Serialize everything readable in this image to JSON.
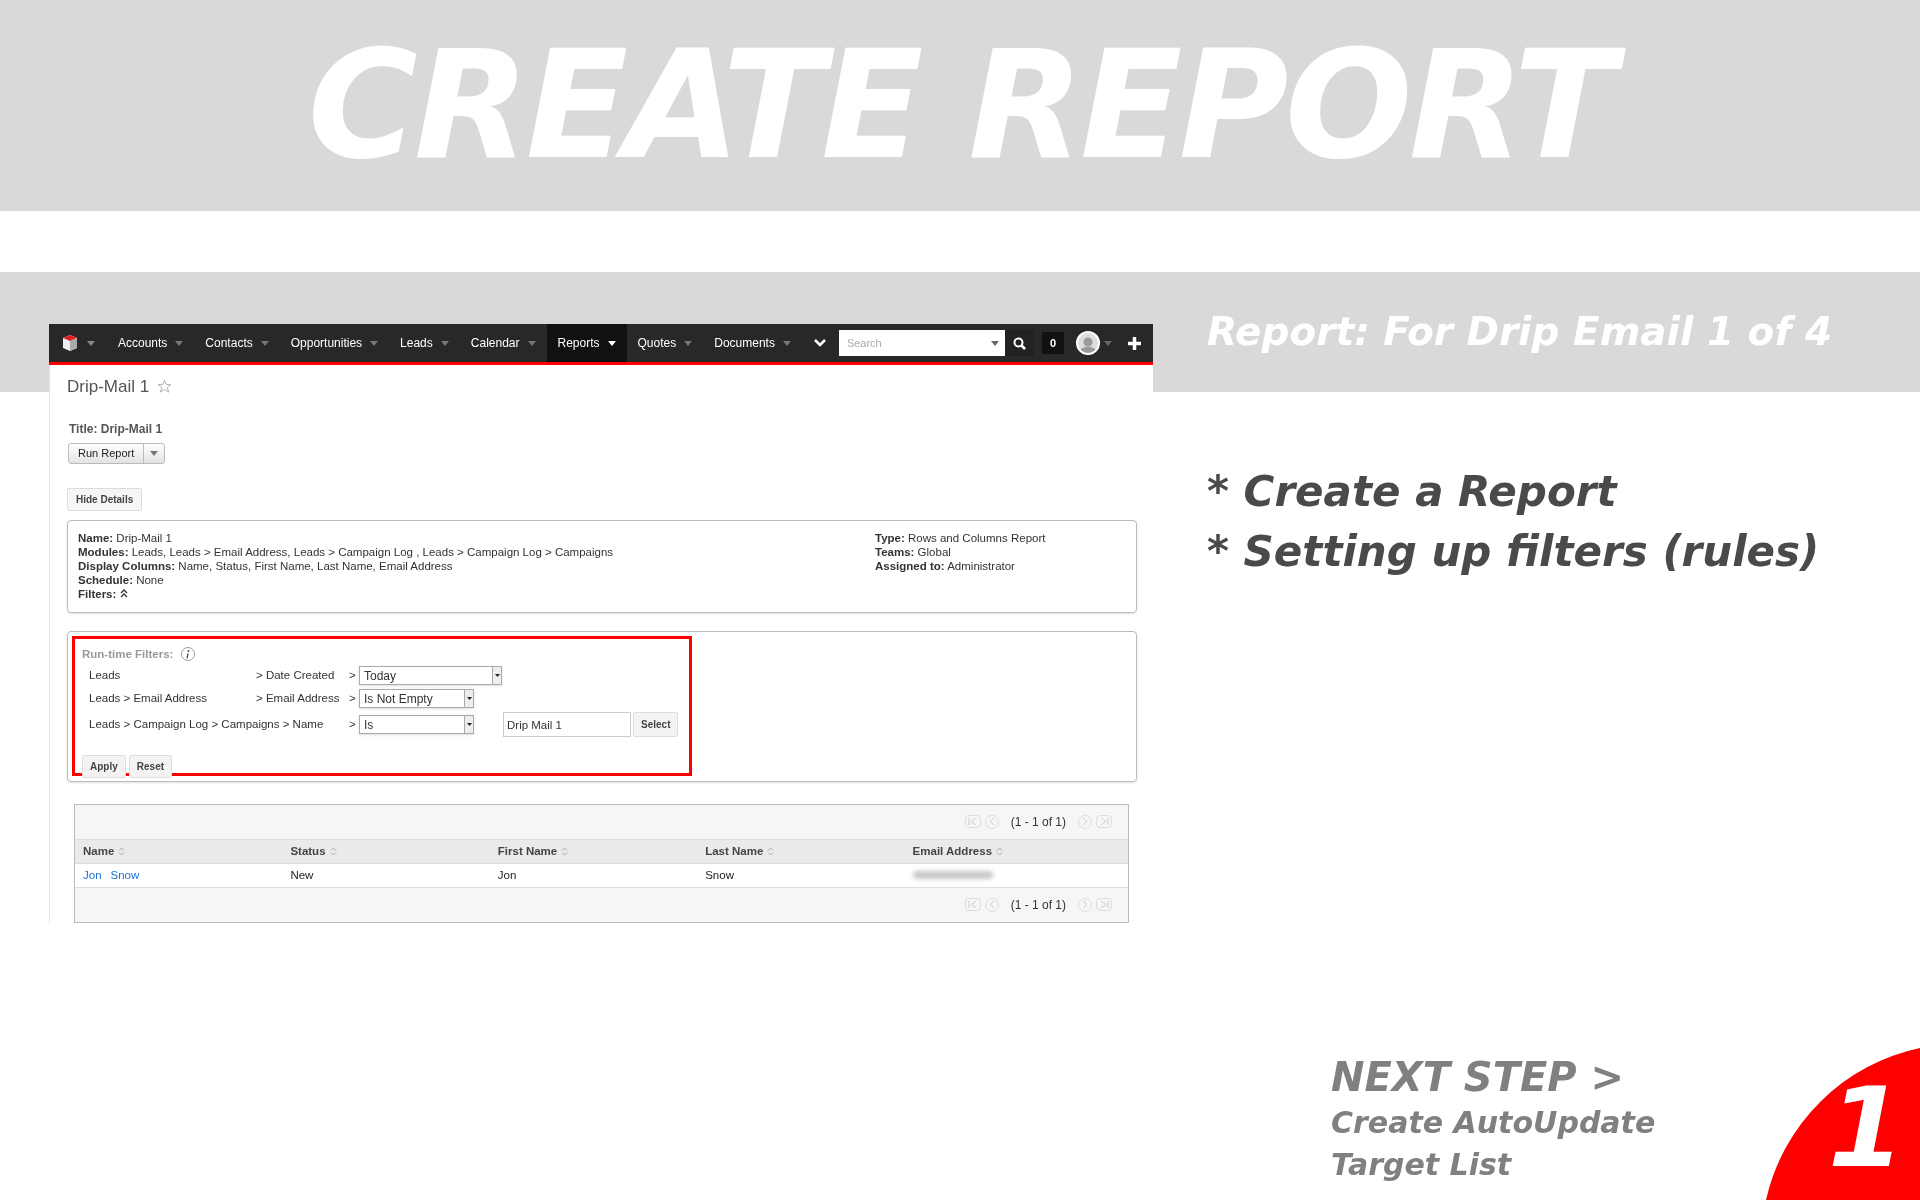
{
  "banner": {
    "title": "CREATE REPORT"
  },
  "subtitle": "Report: For Drip Email 1 of 4",
  "app": {
    "nav": {
      "items": [
        {
          "label": "Accounts",
          "selected": false
        },
        {
          "label": "Contacts",
          "selected": false
        },
        {
          "label": "Opportunities",
          "selected": false
        },
        {
          "label": "Leads",
          "selected": false
        },
        {
          "label": "Calendar",
          "selected": false
        },
        {
          "label": "Reports",
          "selected": true
        },
        {
          "label": "Quotes",
          "selected": false
        },
        {
          "label": "Documents",
          "selected": false
        }
      ],
      "search": {
        "placeholder": "Search"
      },
      "notifications": "0"
    },
    "record_title": "Drip-Mail 1",
    "report_title": "Title: Drip-Mail 1",
    "run_button": "Run Report",
    "hide_details_button": "Hide Details",
    "details_left": [
      {
        "label": "Name:",
        "value": "Drip-Mail 1"
      },
      {
        "label": "Modules:",
        "value": "Leads, Leads > Email Address, Leads > Campaign Log , Leads > Campaign Log > Campaigns"
      },
      {
        "label": "Display Columns:",
        "value": "Name, Status, First Name, Last Name, Email Address"
      },
      {
        "label": "Schedule:",
        "value": "None"
      }
    ],
    "filters_label": "Filters:",
    "details_right": [
      {
        "label": "Type:",
        "value": "Rows and Columns Report"
      },
      {
        "label": "Teams:",
        "value": "Global"
      },
      {
        "label": "Assigned to:",
        "value": "Administrator"
      }
    ],
    "runtime_filters": {
      "title": "Run-time Filters:",
      "rows": [
        {
          "module": "Leads",
          "field": "> Date Created",
          "separator": ">",
          "operator": "Today"
        },
        {
          "module": "Leads > Email Address",
          "field": "> Email Address",
          "separator": ">",
          "operator": "Is Not Empty"
        },
        {
          "module": "Leads > Campaign Log > Campaigns > Name",
          "separator": ">",
          "operator": "Is",
          "value": "Drip Mail 1",
          "button": "Select"
        }
      ],
      "apply": "Apply",
      "reset": "Reset"
    },
    "table": {
      "pagination_top": "(1 - 1 of 1)",
      "columns": [
        "Name",
        "Status",
        "First Name",
        "Last Name",
        "Email Address"
      ],
      "rows": [
        {
          "name": [
            "Jon",
            "Snow"
          ],
          "status": "New",
          "first_name": "Jon",
          "last_name": "Snow"
        }
      ],
      "pagination_bottom": "(1 - 1 of 1)"
    }
  },
  "bullets": [
    "* Create a Report",
    "* Setting up filters (rules)"
  ],
  "next_step": {
    "heading": "NEXT STEP >",
    "lines": [
      "Create AutoUpdate",
      "Target List"
    ]
  },
  "step_number": "1"
}
